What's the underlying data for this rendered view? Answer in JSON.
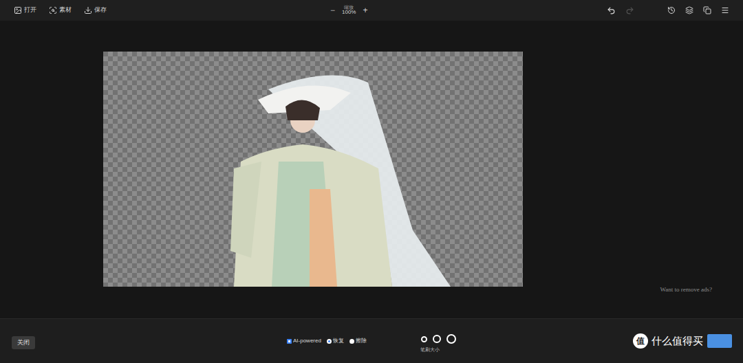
{
  "toolbar": {
    "items": [
      {
        "label": "打开"
      },
      {
        "label": "素材"
      },
      {
        "label": "保存"
      }
    ],
    "zoom": {
      "label": "缩放",
      "value": "100%",
      "minus": "−",
      "plus": "+"
    },
    "undo_enabled": true,
    "redo_enabled": false
  },
  "canvas": {
    "ad_link": "Want to remove ads?"
  },
  "bottom": {
    "close": "关闭",
    "ai": {
      "label": "AI-powered",
      "checked": true
    },
    "modes": [
      {
        "label": "恢复",
        "selected": true
      },
      {
        "label": "擦除",
        "selected": false
      }
    ],
    "brush_sizes": [
      {
        "selected": false
      },
      {
        "selected": false
      },
      {
        "selected": false
      },
      {
        "selected": false
      },
      {
        "selected": false
      }
    ],
    "brush_label": "笔刷大小"
  },
  "watermark": {
    "logo_glyph": "值",
    "text": "什么值得买"
  }
}
